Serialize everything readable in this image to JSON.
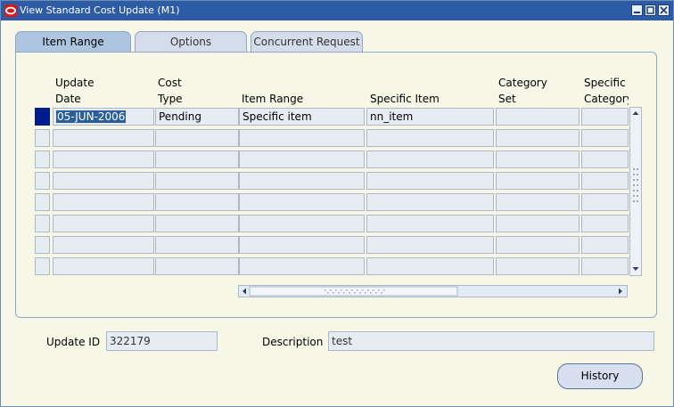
{
  "window": {
    "title": "View Standard Cost Update (M1)"
  },
  "tabs": [
    {
      "label": "Item Range"
    },
    {
      "label": "Options"
    },
    {
      "label": "Concurrent Request"
    }
  ],
  "table": {
    "headers": {
      "update_date": "Update\nDate",
      "cost_type": "Cost\nType",
      "item_range": "Item Range",
      "specific_item": "Specific Item",
      "category_set": "Category\nSet",
      "specific_category": "Specific\nCategory"
    },
    "row1": {
      "update_date": "05-JUN-2006",
      "cost_type": "Pending",
      "item_range": "Specific item",
      "specific_item": "nn_item",
      "category_set": "",
      "specific_category": ""
    }
  },
  "form": {
    "update_id_label": "Update ID",
    "update_id_value": "322179",
    "description_label": "Description",
    "description_value": "test"
  },
  "buttons": {
    "history": "History"
  },
  "colors": {
    "titlebar": "#2e5ba6",
    "active_tab": "#aec5df",
    "selected_row": "#001c8c",
    "background": "#f7f7e7"
  }
}
